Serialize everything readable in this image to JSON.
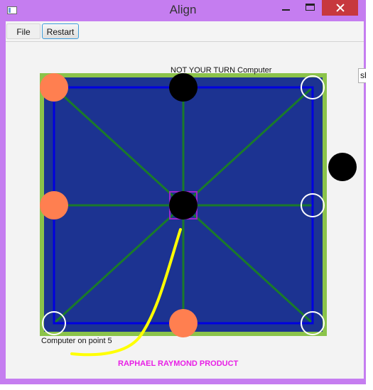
{
  "window": {
    "title": "Align"
  },
  "menu": {
    "file_label": "File",
    "restart_label": "Restart"
  },
  "edge_field": {
    "value": "sh"
  },
  "status": {
    "turn_message": "NOT  YOUR TURN Computer",
    "last_move": "Computer  on point 5"
  },
  "credit": "RAPHAEL RAYMOND PRODUCT",
  "colors": {
    "board_fill": "#1c3391",
    "board_frame": "#8bc34a",
    "grid_lines": "#0000e0",
    "diagonals": "#1a7a2a",
    "player_piece": "#ff7f50",
    "computer_piece": "#000000",
    "empty_point_ring": "#ffffff",
    "trail": "#ffff00",
    "credit_text": "#e81ee6"
  },
  "board": {
    "points": [
      {
        "id": 1,
        "occupant": "player"
      },
      {
        "id": 2,
        "occupant": "computer"
      },
      {
        "id": 3,
        "occupant": "empty"
      },
      {
        "id": 4,
        "occupant": "player"
      },
      {
        "id": 5,
        "occupant": "computer"
      },
      {
        "id": 6,
        "occupant": "empty"
      },
      {
        "id": 7,
        "occupant": "empty"
      },
      {
        "id": 8,
        "occupant": "player"
      },
      {
        "id": 9,
        "occupant": "empty"
      }
    ],
    "selected_point": 5,
    "off_board_pieces": [
      {
        "occupant": "computer"
      }
    ]
  }
}
